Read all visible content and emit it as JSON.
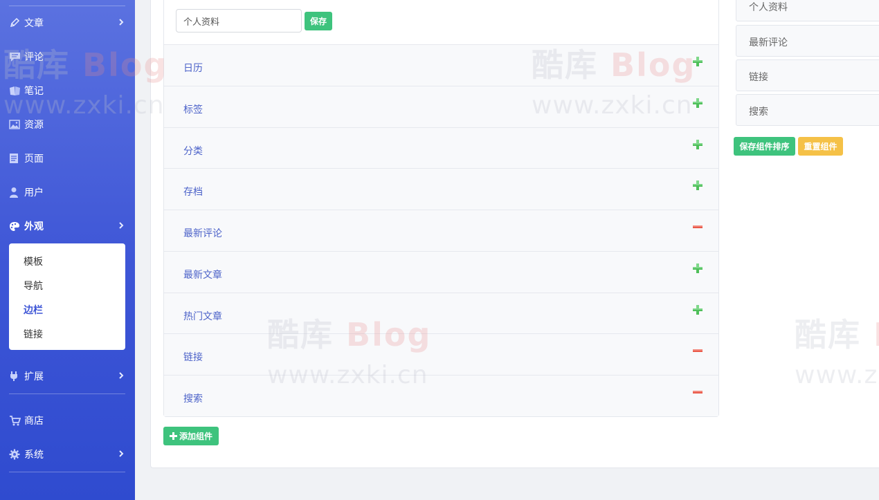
{
  "sidebar": {
    "items": [
      {
        "label": "文章",
        "icon": "pencil-icon",
        "chevron": true
      },
      {
        "label": "评论",
        "icon": "comment-icon",
        "chevron": false
      },
      {
        "label": "笔记",
        "icon": "notebook-icon",
        "chevron": false
      },
      {
        "label": "资源",
        "icon": "image-icon",
        "chevron": false
      },
      {
        "label": "页面",
        "icon": "page-icon",
        "chevron": false
      },
      {
        "label": "用户",
        "icon": "user-icon",
        "chevron": false
      },
      {
        "label": "外观",
        "icon": "palette-icon",
        "chevron": true
      },
      {
        "label": "扩展",
        "icon": "plug-icon",
        "chevron": true
      },
      {
        "label": "商店",
        "icon": "cart-icon",
        "chevron": false
      },
      {
        "label": "系统",
        "icon": "gear-icon",
        "chevron": true
      }
    ],
    "submenu": [
      {
        "label": "模板"
      },
      {
        "label": "导航"
      },
      {
        "label": "边栏"
      },
      {
        "label": "链接"
      }
    ]
  },
  "widget_editor": {
    "title_value": "个人资料",
    "save_label": "保存",
    "add_label": "添加组件"
  },
  "widgets": [
    {
      "label": "日历",
      "action": "add"
    },
    {
      "label": "标签",
      "action": "add"
    },
    {
      "label": "分类",
      "action": "add"
    },
    {
      "label": "存档",
      "action": "add"
    },
    {
      "label": "最新评论",
      "action": "remove"
    },
    {
      "label": "最新文章",
      "action": "add"
    },
    {
      "label": "热门文章",
      "action": "add"
    },
    {
      "label": "链接",
      "action": "remove"
    },
    {
      "label": "搜索",
      "action": "remove"
    }
  ],
  "active_widgets": [
    {
      "label": "个人资料"
    },
    {
      "label": "最新评论"
    },
    {
      "label": "链接"
    },
    {
      "label": "搜索"
    }
  ],
  "actions": {
    "save_order_label": "保存组件排序",
    "reset_label": "重置组件"
  },
  "watermark": {
    "brand_cn": "酷库",
    "brand_en": "Blog",
    "url": "www.zxki.cn"
  },
  "colors": {
    "sidebar": "#3d55d6",
    "accent_green": "#3ec37d",
    "accent_yellow": "#f5c147",
    "remove_red": "#ea5a4a",
    "link_blue": "#4d63c9"
  }
}
